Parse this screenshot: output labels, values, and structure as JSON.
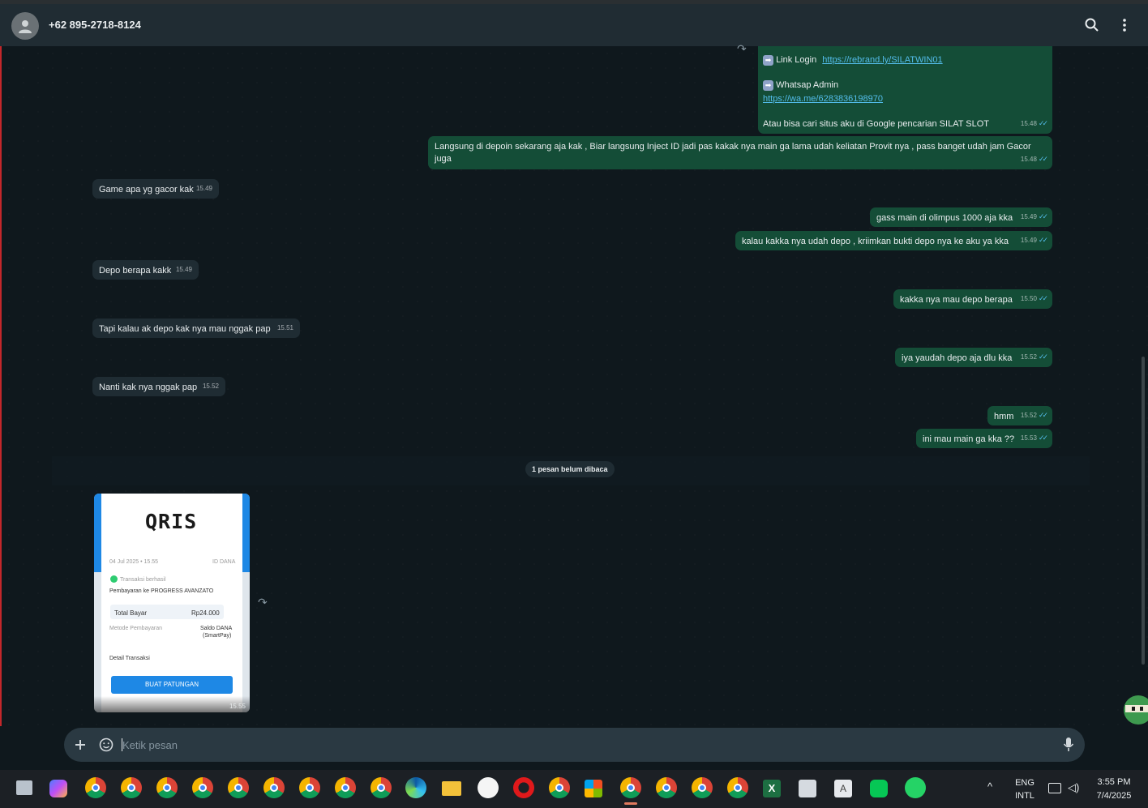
{
  "header": {
    "contact": "+62 895-2718-8124"
  },
  "messages": {
    "m1_link_label": "Link Login",
    "m1_link_url": "https://rebrand.ly/SILATWIN01",
    "m1_wa_label": "Whatsap Admin",
    "m1_wa_url": "https://wa.me/6283836198970",
    "m1_text": "Atau bisa cari situs aku di Google pencarian SILAT SLOT",
    "m1_time": "15.48",
    "m2_text": "Langsung di depoin sekarang aja kak , Biar langsung Inject ID jadi pas kakak nya main ga lama udah keliatan Provit nya , pass banget udah jam Gacor juga",
    "m2_time": "15.48",
    "m3_text": "Game apa yg gacor kak",
    "m3_time": "15.49",
    "m4_text": "gass main di olimpus 1000 aja kka",
    "m4_time": "15.49",
    "m5_text": "kalau kakka nya udah depo , kriimkan bukti depo nya ke aku ya kka",
    "m5_time": "15.49",
    "m6_text": "Depo berapa kakk",
    "m6_time": "15.49",
    "m7_text": "kakka nya mau depo berapa",
    "m7_time": "15.50",
    "m8_text": "Tapi kalau ak depo kak nya mau nggak pap",
    "m8_time": "15.51",
    "m9_text": "iya yaudah depo aja dlu kka",
    "m9_time": "15.52",
    "m10_text": "Nanti kak nya nggak pap",
    "m10_time": "15.52",
    "m11_text": "hmm",
    "m11_time": "15.52",
    "m12_text": "ini mau main ga kka ??",
    "m12_time": "15.53"
  },
  "unread_label": "1 pesan belum dibaca",
  "receipt": {
    "logo": "QRIS",
    "date": "04 Jul 2025 • 15.55",
    "id_label": "ID DANA",
    "status": "Transaksi berhasil",
    "payee": "Pembayaran ke PROGRESS AVANZATO",
    "total_label": "Total Bayar",
    "total_value": "Rp24.000",
    "method_label": "Metode Pembayaran",
    "method_value_1": "Saldo DANA",
    "method_value_2": "(SmartPay)",
    "detail_label": "Detail Transaksi",
    "button_label": "BUAT PATUNGAN",
    "time": "15.55"
  },
  "composer": {
    "placeholder": "Ketik pesan"
  },
  "taskbar": {
    "lang_1": "ENG",
    "lang_2": "INTL",
    "time": "3:55 PM",
    "date": "7/4/2025"
  },
  "colors": {
    "outgoing_bubble": "#144d37",
    "incoming_bubble": "#1f2c33",
    "tick": "#53bdeb",
    "header": "#202c33"
  }
}
